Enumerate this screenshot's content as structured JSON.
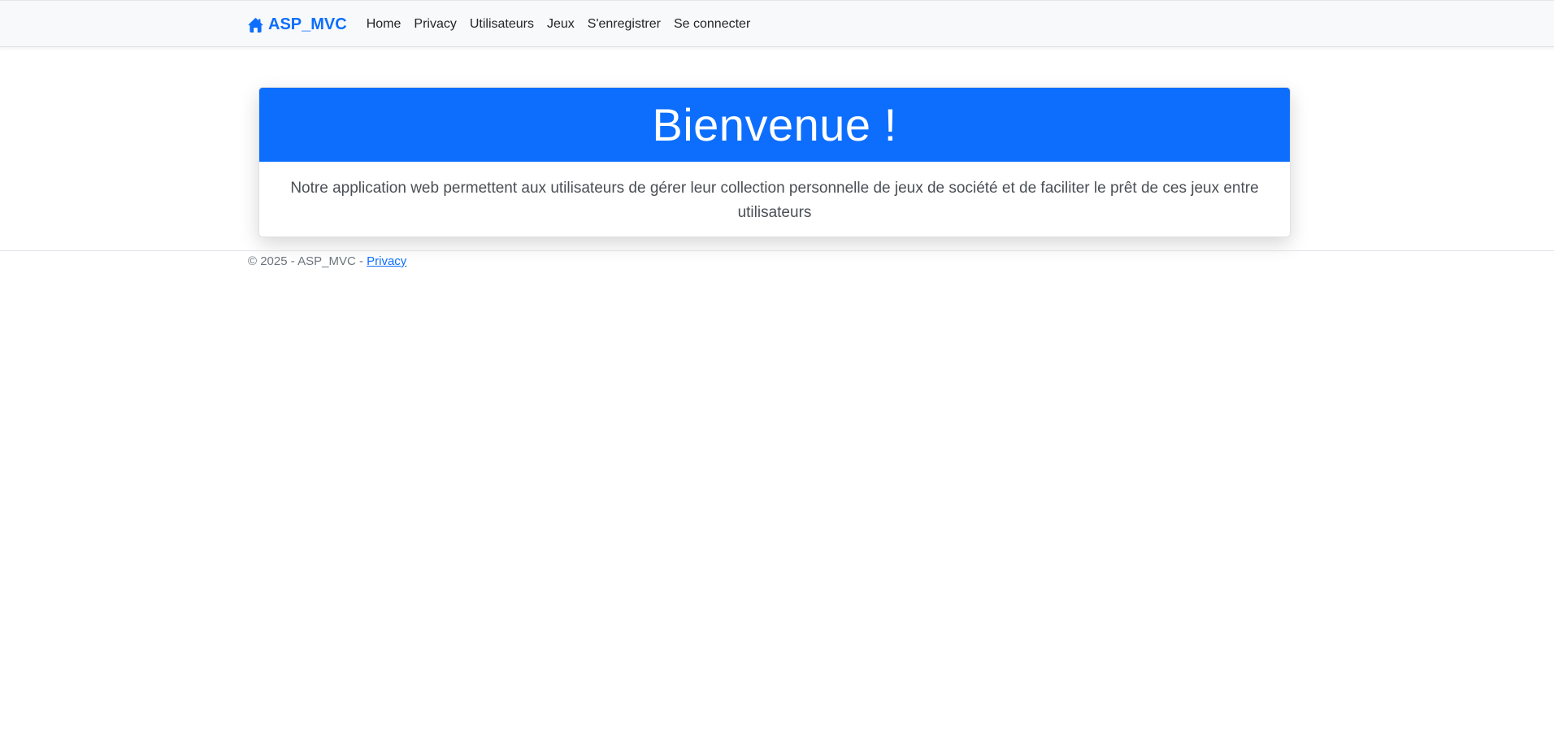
{
  "navbar": {
    "brand": "ASP_MVC",
    "brand_icon": "home-icon",
    "links": [
      "Home",
      "Privacy",
      "Utilisateurs",
      "Jeux",
      "S'enregistrer",
      "Se connecter"
    ]
  },
  "hero": {
    "title": "Bienvenue !",
    "description": "Notre application web permettent aux utilisateurs de gérer leur collection personnelle de jeux de société et de faciliter le prêt de ces jeux entre utilisateurs"
  },
  "footer": {
    "copyright": "© 2025 - ASP_MVC - ",
    "privacy_link": "Privacy"
  },
  "colors": {
    "primary": "#0d6efd",
    "navbar_bg": "#f8f9fa"
  }
}
